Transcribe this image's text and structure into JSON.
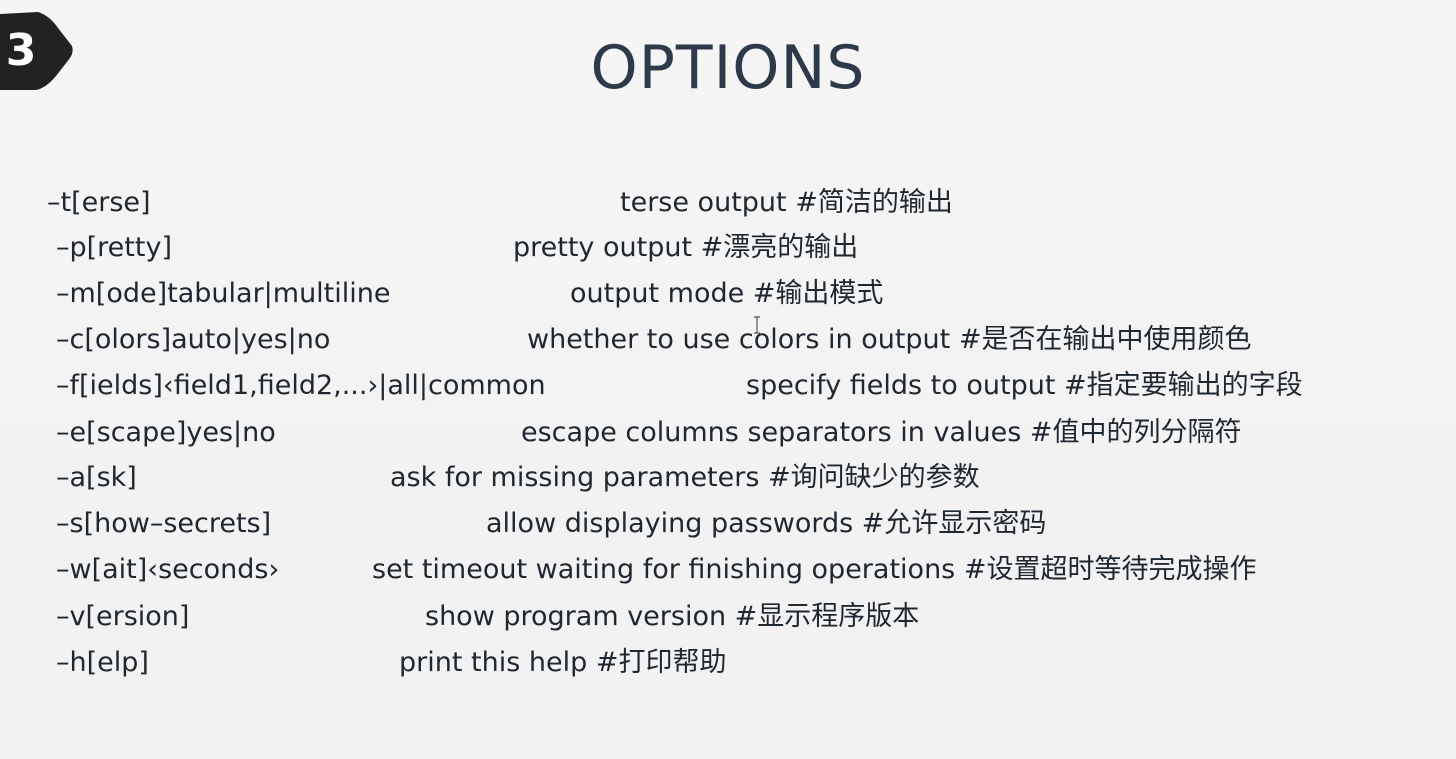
{
  "slide": {
    "step_number": "3",
    "title": "OPTIONS"
  },
  "options": [
    {
      "flag": "–t[erse]",
      "description": "terse output #简洁的输出"
    },
    {
      "flag": "–p[retty]",
      "description": "pretty output  #漂亮的输出"
    },
    {
      "flag": "–m[ode]tabular|multiline",
      "description": "output mode  #输出模式"
    },
    {
      "flag": "–c[olors]auto|yes|no",
      "description": "whether to use colors in output #是否在输出中使用颜色"
    },
    {
      "flag": "–f[ields]‹field1,field2,...›|all|common",
      "description": "specify fields to output #指定要输出的字段"
    },
    {
      "flag": "–e[scape]yes|no",
      "description": "escape columns separators in values #值中的列分隔符"
    },
    {
      "flag": "–a[sk]",
      "description": "ask for missing parameters #询问缺少的参数"
    },
    {
      "flag": "–s[how–secrets]",
      "description": "allow displaying passwords  #允许显示密码"
    },
    {
      "flag": "–w[ait]‹seconds›",
      "description": "set timeout waiting for finishing operations #设置超时等待完成操作"
    },
    {
      "flag": "–v[ersion]",
      "description": "show program version #显示程序版本"
    },
    {
      "flag": "–h[elp]",
      "description": "print this help #打印帮助"
    }
  ],
  "colors": {
    "background": "#f3f3f3",
    "title": "#2e3a4a",
    "text": "#1f2730",
    "badge": "#222222"
  }
}
